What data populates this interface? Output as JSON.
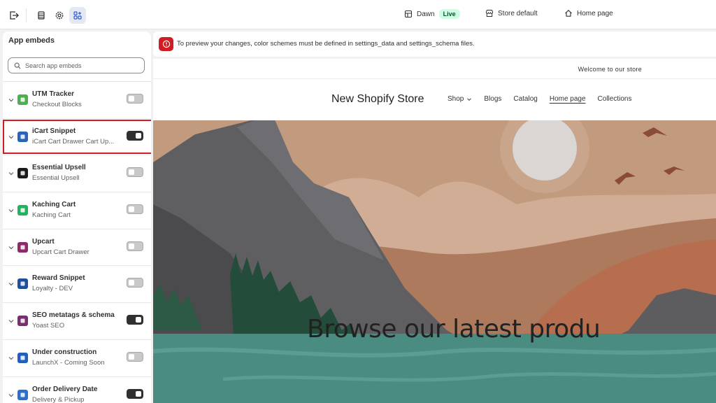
{
  "topbar": {
    "theme_name": "Dawn",
    "theme_status": "Live",
    "store_selector": "Store default",
    "page_selector": "Home page"
  },
  "sidebar": {
    "title": "App embeds",
    "search_placeholder": "Search app embeds",
    "items": [
      {
        "name": "UTM Tracker",
        "subtitle": "Checkout Blocks",
        "enabled": false,
        "icon": "utm-tracker-app-icon",
        "icon_color": "#4caf50"
      },
      {
        "name": "iCart Snippet",
        "subtitle": "iCart Cart Drawer Cart Up...",
        "enabled": true,
        "icon": "icart-app-icon",
        "icon_color": "#2a63b8"
      },
      {
        "name": "Essential Upsell",
        "subtitle": "Essential Upsell",
        "enabled": false,
        "icon": "essential-upsell-app-icon",
        "icon_color": "#1a1a1a"
      },
      {
        "name": "Kaching Cart",
        "subtitle": "Kaching Cart",
        "enabled": false,
        "icon": "kaching-cart-app-icon",
        "icon_color": "#22b35e"
      },
      {
        "name": "Upcart",
        "subtitle": "Upcart Cart Drawer",
        "enabled": false,
        "icon": "upcart-app-icon",
        "icon_color": "#8e2a6a"
      },
      {
        "name": "Reward Snippet",
        "subtitle": "Loyalty - DEV",
        "enabled": false,
        "icon": "reward-snippet-app-icon",
        "icon_color": "#1e4f9c"
      },
      {
        "name": "SEO metatags & schema",
        "subtitle": "Yoast SEO",
        "enabled": true,
        "icon": "yoast-seo-app-icon",
        "icon_color": "#7a2e6e"
      },
      {
        "name": "Under construction",
        "subtitle": "LaunchX - Coming Soon",
        "enabled": false,
        "icon": "launchx-app-icon",
        "icon_color": "#1f5fbf"
      },
      {
        "name": "Order Delivery Date",
        "subtitle": "Delivery & Pickup",
        "enabled": true,
        "icon": "order-delivery-app-icon",
        "icon_color": "#2a6fcf"
      }
    ]
  },
  "banner": {
    "message": "To preview your changes, color schemes must be defined in settings_data and settings_schema files."
  },
  "store": {
    "welcome": "Welcome to our store",
    "name": "New Shopify Store",
    "nav": [
      "Shop",
      "Blogs",
      "Catalog",
      "Home page",
      "Collections"
    ],
    "current_nav": "Home page",
    "hero_heading": "Browse our latest produ"
  },
  "colors": {
    "accent_red": "#d21c23",
    "toggle_on": "#303030",
    "live_badge": "#cdfee1"
  }
}
